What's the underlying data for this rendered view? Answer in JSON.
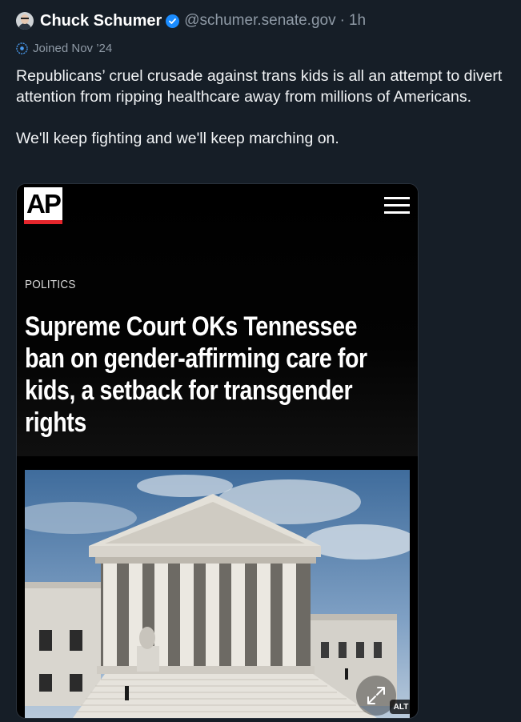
{
  "post": {
    "author_name": "Chuck Schumer",
    "handle": "@schumer.senate.gov",
    "separator": "·",
    "time": "1h",
    "joined": "Joined Nov ’24",
    "text": "Republicans’ cruel crusade against trans kids is all an attempt to divert attention from ripping healthcare away from millions of Americans.\n\nWe'll keep fighting and we'll keep marching on."
  },
  "card": {
    "logo": "AP",
    "section": "POLITICS",
    "headline": "Supreme Court OKs Tennessee ban on gender-affirming care for kids, a setback for transgender rights",
    "alt_badge": "ALT"
  },
  "icons": {
    "verified": "verified-check-icon",
    "joined": "bluesky-butterfly-icon",
    "menu": "hamburger-menu-icon",
    "expand": "expand-arrows-icon"
  },
  "colors": {
    "background": "#161e27",
    "verified_blue": "#1a8cff",
    "ap_red": "#e5262c",
    "muted_text": "#8f9aa6"
  }
}
